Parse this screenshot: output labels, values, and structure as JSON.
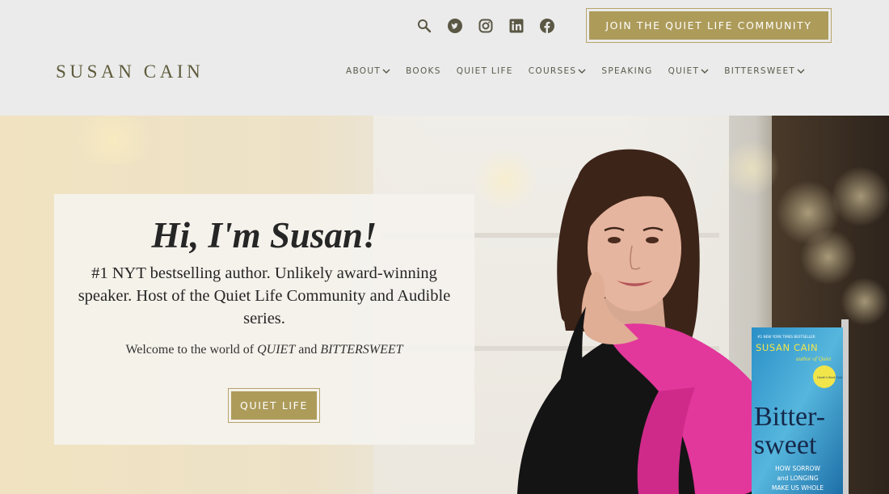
{
  "header": {
    "logo": "SUSAN CAIN",
    "join_button": "JOIN THE QUIET LIFE COMMUNITY",
    "icons": [
      "search-icon",
      "twitter-icon",
      "instagram-icon",
      "linkedin-icon",
      "facebook-icon"
    ],
    "nav": [
      {
        "label": "ABOUT",
        "dropdown": true
      },
      {
        "label": "BOOKS",
        "dropdown": false
      },
      {
        "label": "QUIET LIFE",
        "dropdown": false
      },
      {
        "label": "COURSES",
        "dropdown": true
      },
      {
        "label": "SPEAKING",
        "dropdown": false
      },
      {
        "label": "QUIET",
        "dropdown": true
      },
      {
        "label": "BITTERSWEET",
        "dropdown": true
      }
    ]
  },
  "hero": {
    "greeting": "Hi, I'm Susan!",
    "intro": "#1 NYT bestselling author. Unlikely award-winning speaker. Host of the Quiet Life Community and Audible series.",
    "welcome_prefix": "Welcome to the world of ",
    "welcome_book1": "QUIET",
    "welcome_and": " and ",
    "welcome_book2": "BITTERSWEET",
    "button": "QUIET LIFE"
  },
  "book": {
    "tagline": "#1 NEW YORK TIMES BESTSELLER",
    "author": "SUSAN CAIN",
    "author_of": "author of Quiet",
    "badge": "Oprah's Book Club",
    "title_line1": "Bitter-",
    "title_line2": "sweet",
    "subtitle_line1": "HOW SORROW",
    "subtitle_line2": "and LONGING",
    "subtitle_line3": "MAKE US WHOLE"
  },
  "colors": {
    "accent_gold": "#ad9b5a",
    "header_bg": "#ebebeb",
    "logo": "#5d5a3a",
    "scarf_pink": "#e2379b"
  }
}
